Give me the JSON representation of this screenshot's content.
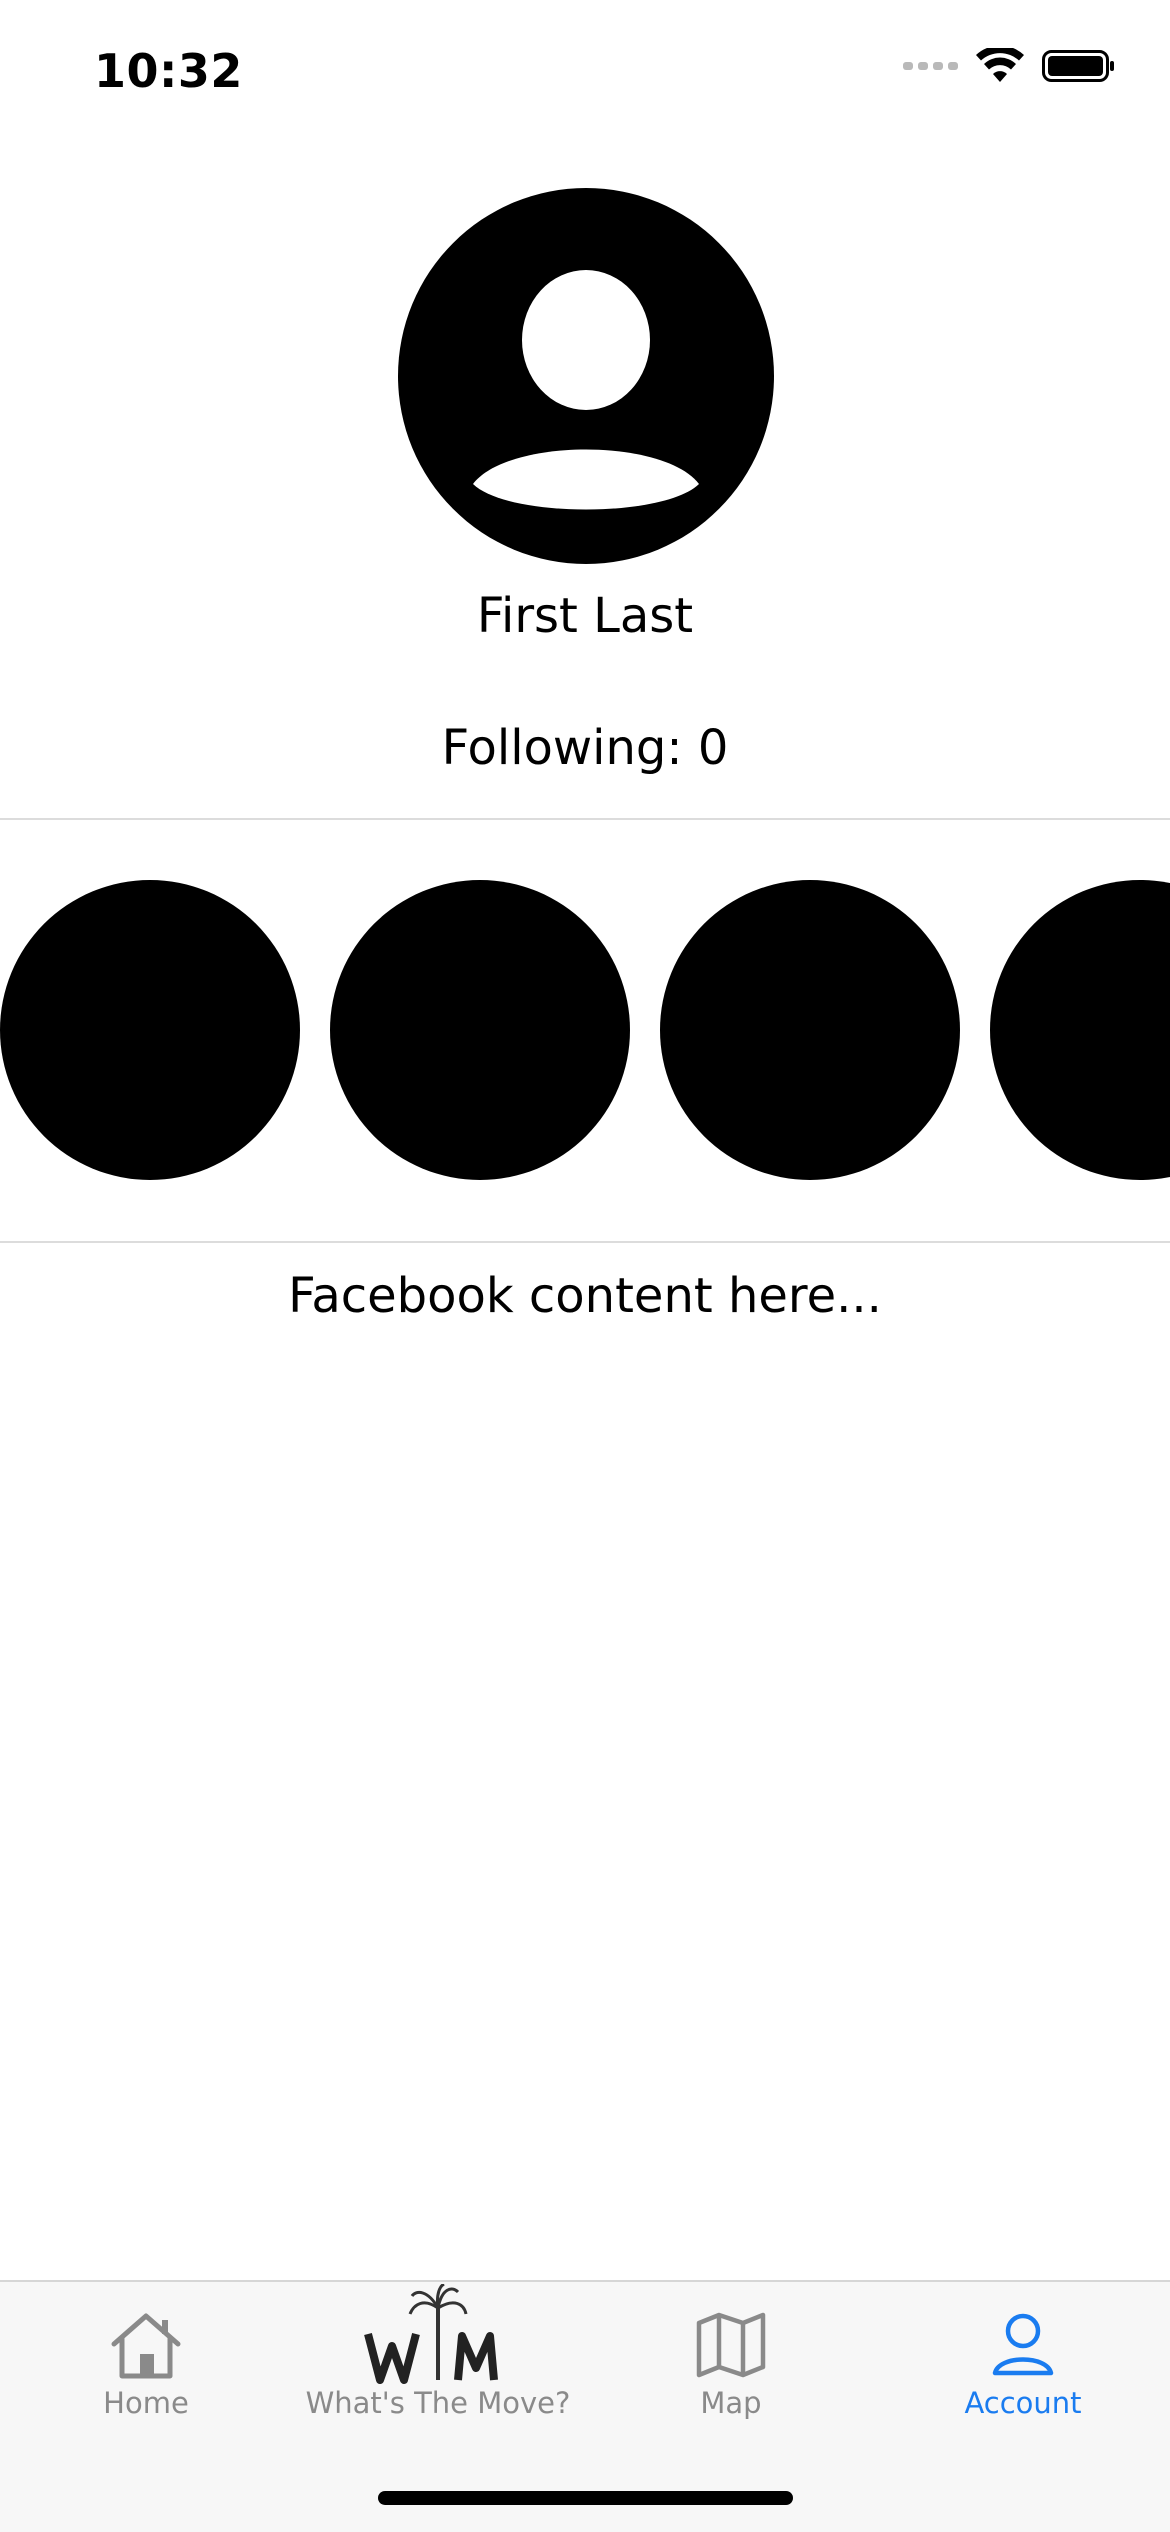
{
  "status_bar": {
    "time": "10:32",
    "icons": [
      "cellular-signal-icon",
      "wifi-icon",
      "battery-icon"
    ]
  },
  "profile": {
    "avatar_icon": "person-circle-icon",
    "name": "First Last",
    "following_text": "Following: 0"
  },
  "following_list": {
    "items": [
      "avatar-circle",
      "avatar-circle",
      "avatar-circle",
      "avatar-circle"
    ]
  },
  "feed": {
    "placeholder_text": "Facebook content here..."
  },
  "tab_bar": {
    "tabs": [
      {
        "label": "Home",
        "icon": "house-icon",
        "active": false
      },
      {
        "label": "What's The Move?",
        "icon": "wtm-palm-logo",
        "active": false
      },
      {
        "label": "Map",
        "icon": "map-icon",
        "active": false
      },
      {
        "label": "Account",
        "icon": "person-icon",
        "active": true
      }
    ]
  },
  "colors": {
    "accent": "#1a7cf0",
    "inactive": "#8a8a8a",
    "tab_bar_bg": "#f7f7f7",
    "divider": "#dcdcdc"
  }
}
